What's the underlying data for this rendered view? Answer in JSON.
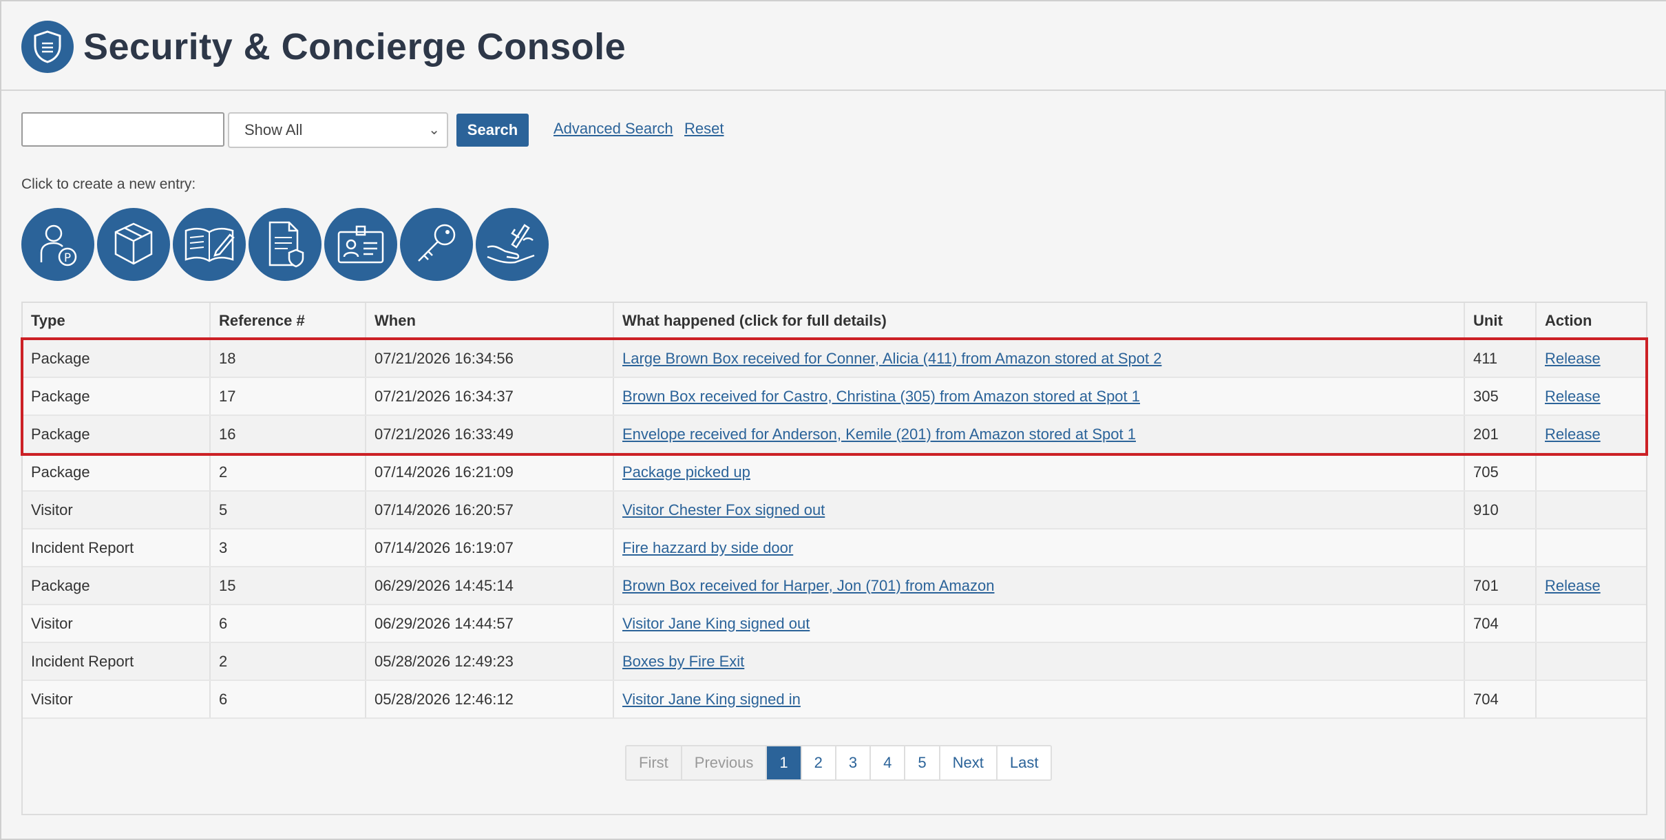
{
  "header": {
    "title": "Security & Concierge Console",
    "logo_icon": "shield-icon"
  },
  "search": {
    "input_value": "",
    "filter_selected": "Show All",
    "search_label": "Search",
    "advanced_label": "Advanced Search",
    "reset_label": "Reset"
  },
  "create": {
    "label": "Click to create a new entry:",
    "buttons": [
      {
        "icon": "visitor-parking-icon"
      },
      {
        "icon": "package-icon"
      },
      {
        "icon": "logbook-icon"
      },
      {
        "icon": "incident-report-icon"
      },
      {
        "icon": "id-badge-icon"
      },
      {
        "icon": "key-icon"
      },
      {
        "icon": "handshake-sign-icon"
      }
    ]
  },
  "table": {
    "headers": [
      "Type",
      "Reference #",
      "When",
      "What happened (click for full details)",
      "Unit",
      "Action"
    ],
    "rows": [
      {
        "type": "Package",
        "ref": "18",
        "when": "07/21/2026 16:34:56",
        "what": "Large Brown Box received for Conner, Alicia (411) from Amazon stored at Spot 2",
        "unit": "411",
        "action": "Release"
      },
      {
        "type": "Package",
        "ref": "17",
        "when": "07/21/2026 16:34:37",
        "what": "Brown Box received for Castro, Christina (305) from Amazon stored at Spot 1",
        "unit": "305",
        "action": "Release"
      },
      {
        "type": "Package",
        "ref": "16",
        "when": "07/21/2026 16:33:49",
        "what": "Envelope received for Anderson, Kemile (201) from Amazon stored at Spot 1",
        "unit": "201",
        "action": "Release"
      },
      {
        "type": "Package",
        "ref": "2",
        "when": "07/14/2026 16:21:09",
        "what": "Package picked up",
        "unit": "705",
        "action": ""
      },
      {
        "type": "Visitor",
        "ref": "5",
        "when": "07/14/2026 16:20:57",
        "what": "Visitor Chester Fox signed out",
        "unit": "910",
        "action": ""
      },
      {
        "type": "Incident Report",
        "ref": "3",
        "when": "07/14/2026 16:19:07",
        "what": "Fire hazzard by side door",
        "unit": "",
        "action": ""
      },
      {
        "type": "Package",
        "ref": "15",
        "when": "06/29/2026 14:45:14",
        "what": "Brown Box received for Harper, Jon (701) from Amazon",
        "unit": "701",
        "action": "Release"
      },
      {
        "type": "Visitor",
        "ref": "6",
        "when": "06/29/2026 14:44:57",
        "what": "Visitor Jane King signed out",
        "unit": "704",
        "action": ""
      },
      {
        "type": "Incident Report",
        "ref": "2",
        "when": "05/28/2026 12:49:23",
        "what": "Boxes by Fire Exit",
        "unit": "",
        "action": ""
      },
      {
        "type": "Visitor",
        "ref": "6",
        "when": "05/28/2026 12:46:12",
        "what": "Visitor Jane King signed in",
        "unit": "704",
        "action": ""
      }
    ]
  },
  "pagination": {
    "first": "First",
    "previous": "Previous",
    "pages": [
      "1",
      "2",
      "3",
      "4",
      "5"
    ],
    "current": "1",
    "next": "Next",
    "last": "Last"
  },
  "colors": {
    "accent": "#2b6399",
    "highlight": "#cc2025"
  }
}
